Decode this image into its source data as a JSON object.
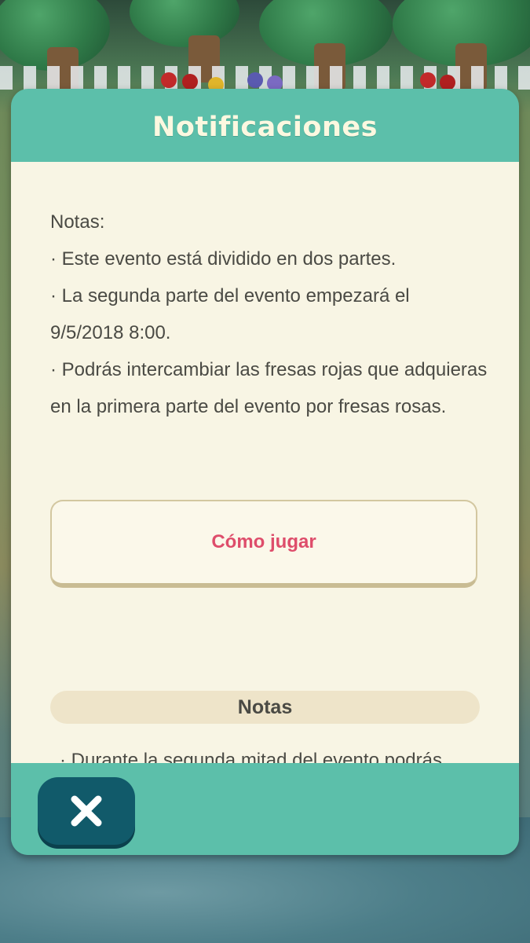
{
  "dialog": {
    "title": "Notificaciones",
    "notes": [
      "Notas:",
      "· Este evento está dividido en dos partes.",
      "· La segunda parte del evento empezará el 9/5/2018 8:00.",
      "· Podrás intercambiar las fresas rojas que adquieras en la primera parte del evento por fresas rosas."
    ],
    "how_to_play_label": "Cómo jugar",
    "section_title": "Notas",
    "cut_off_text": "· Durante la segunda mitad del evento podrás",
    "close_icon": "close-icon"
  },
  "colors": {
    "header": "#5cbfaa",
    "body": "#f8f5e4",
    "accent_text": "#de4d6b",
    "close_button": "#115a6a"
  }
}
